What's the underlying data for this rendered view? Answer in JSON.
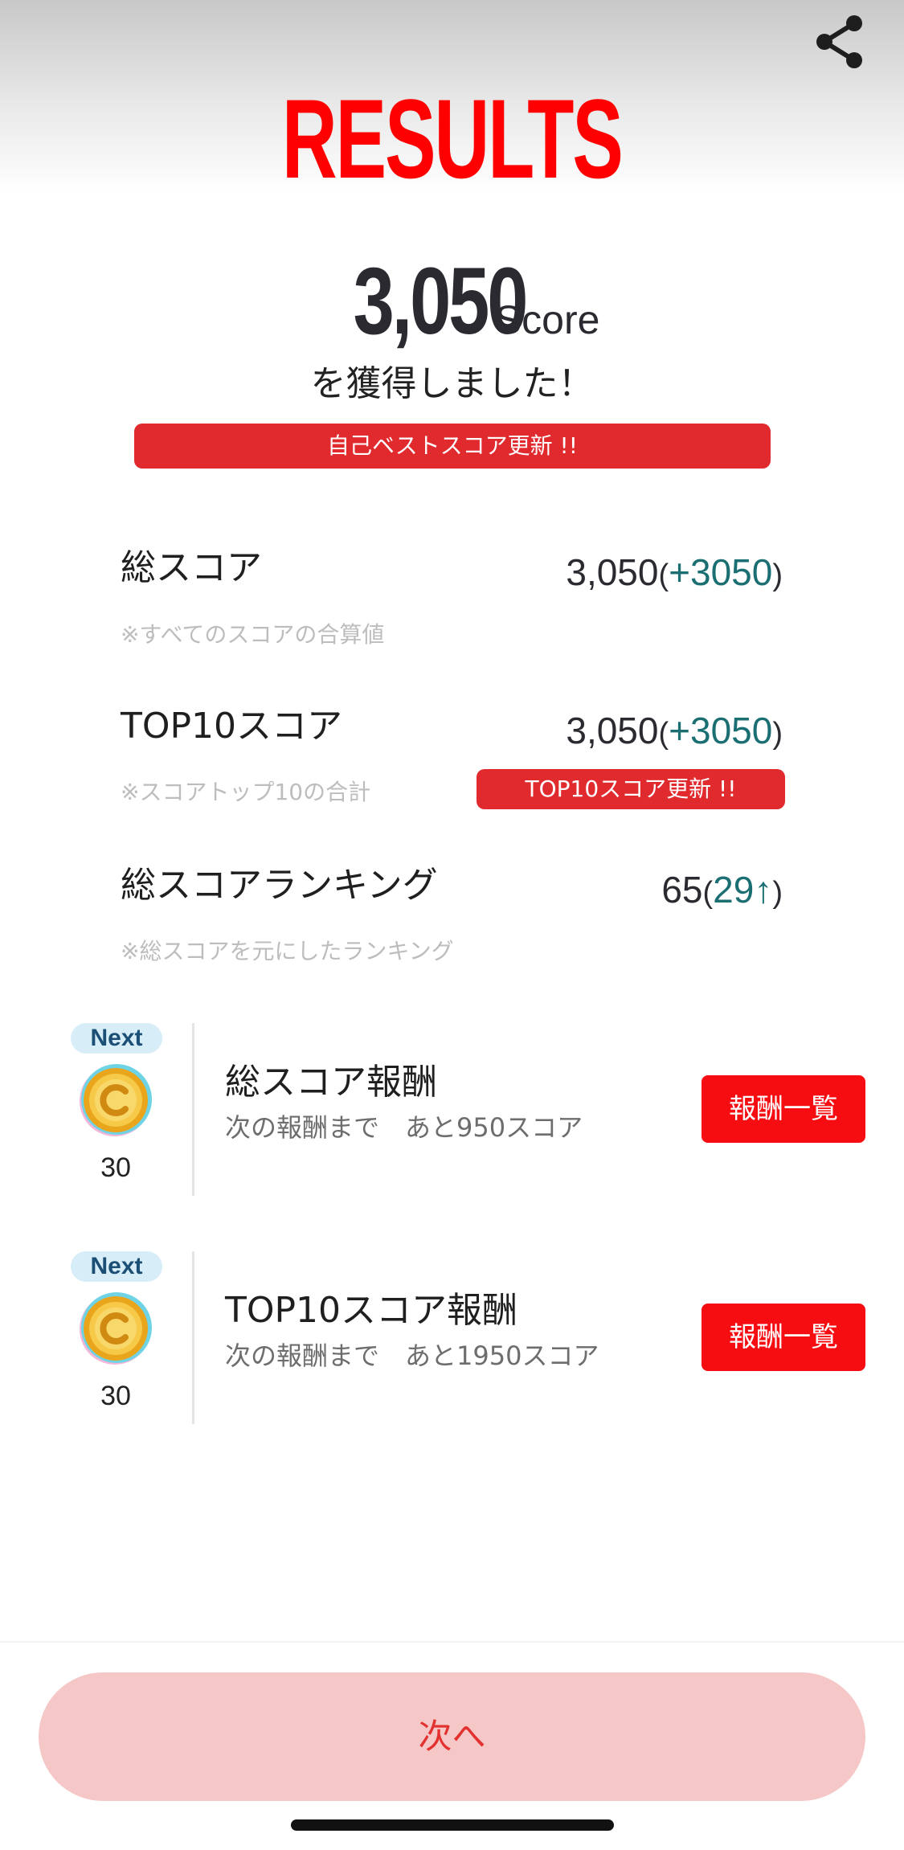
{
  "header": {
    "title": "RESULTS",
    "share_icon": "share-icon"
  },
  "score": {
    "value": "3,050",
    "unit": "Score",
    "acquired_text": "を獲得しました！",
    "best_banner": "自己ベストスコア更新 !!"
  },
  "stats": {
    "total": {
      "label": "総スコア",
      "note": "※すべてのスコアの合算値",
      "value": "3,050",
      "delta": "+3050"
    },
    "top10": {
      "label": "TOP10スコア",
      "note": "※スコアトップ10の合計",
      "value": "3,050",
      "delta": "+3050",
      "banner": "TOP10スコア更新 !!"
    },
    "ranking": {
      "label": "総スコアランキング",
      "note": "※総スコアを元にしたランキング",
      "value": "65",
      "delta": "29↑"
    }
  },
  "rewards": [
    {
      "badge": "Next",
      "coin_count": "30",
      "title": "総スコア報酬",
      "subtitle": "次の報酬まで　あと950スコア",
      "button": "報酬一覧"
    },
    {
      "badge": "Next",
      "coin_count": "30",
      "title": "TOP10スコア報酬",
      "subtitle": "次の報酬まで　あと1950スコア",
      "button": "報酬一覧"
    }
  ],
  "footer": {
    "next_button": "次へ"
  },
  "colors": {
    "title_red": "#ff0000",
    "banner_red": "#e02a2e",
    "button_red": "#f50d12",
    "delta_teal": "#1b6f73",
    "next_button_bg": "#f5c7c7",
    "next_button_text": "#e2312f",
    "badge_bg": "#d7eef8"
  }
}
